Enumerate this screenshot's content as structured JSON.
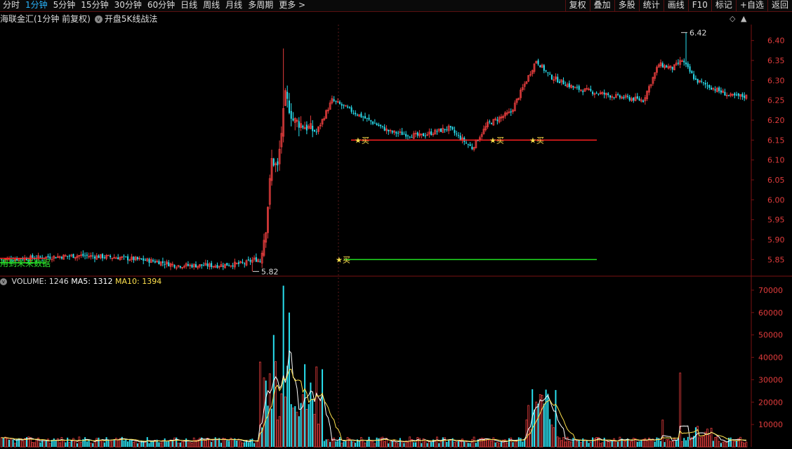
{
  "toolbar": {
    "periods": [
      "分时",
      "1分钟",
      "5分钟",
      "15分钟",
      "30分钟",
      "60分钟",
      "日线",
      "周线",
      "月线",
      "多周期",
      "更多 >"
    ],
    "active_period": "1分钟",
    "right_buttons": [
      "复权",
      "叠加",
      "多股",
      "统计",
      "画线",
      "F10",
      "标记",
      "+自选",
      "返回"
    ]
  },
  "chart_title": "海联金汇(1分钟 前复权)",
  "indicator_name": "开盘5K线战法",
  "future_data_label": "用到未来数据",
  "volume_header": {
    "volume": "VOLUME: 1246",
    "ma5": "MA5: 1312",
    "ma10": "MA10: 1394"
  },
  "colors": {
    "up": "#e23c3c",
    "down": "#29e0f0",
    "ma5": "#ffffff",
    "ma10": "#ffe14d",
    "support": "#22e022",
    "resist": "#ff2020",
    "axis": "#7a1212"
  },
  "chart_data": [
    {
      "type": "candlestick",
      "ylim": [
        5.81,
        6.44
      ],
      "yticks": [
        5.85,
        5.9,
        5.95,
        6.0,
        6.05,
        6.1,
        6.15,
        6.2,
        6.25,
        6.3,
        6.35,
        6.4
      ],
      "annotations": [
        {
          "label": "6.42",
          "value": 6.42
        },
        {
          "label": "5.82",
          "value": 5.82
        }
      ],
      "resistance_line": 6.15,
      "support_line": 5.85,
      "buy_signals": [
        {
          "label": "★买",
          "price": 6.15
        },
        {
          "label": "★买",
          "price": 6.15
        },
        {
          "label": "★买",
          "price": 6.15
        },
        {
          "label": "★买",
          "price": 5.85
        }
      ]
    },
    {
      "type": "bar",
      "title": "VOLUME",
      "ylim": [
        0,
        75000
      ],
      "yticks": [
        10000,
        20000,
        30000,
        40000,
        50000,
        60000,
        70000
      ],
      "series": [
        {
          "name": "MA5"
        },
        {
          "name": "MA10"
        }
      ]
    }
  ]
}
